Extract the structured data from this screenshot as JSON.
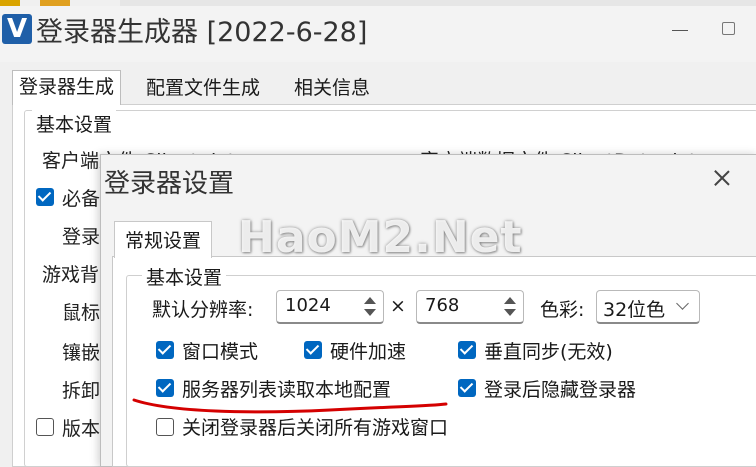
{
  "main_window": {
    "title": "登录器生成器 [2022-6-28]",
    "app_icon_letter": "V",
    "tabs": [
      "登录器生成",
      "配置文件生成",
      "相关信息"
    ],
    "group_title": "基本设置",
    "client_file_label": "客户端文件 Client.dat",
    "client_data_file_label": "客户端数据文件 ClientData.dat",
    "required_label_partial": "必备",
    "login_label_partial": "登录",
    "game_bg_label_partial": "游戏背",
    "mouse_label_partial": "鼠标",
    "embed_label_partial": "镶嵌",
    "split_label_partial": "拆卸",
    "version_label_partial": "版本"
  },
  "dialog": {
    "title": "登录器设置",
    "tabs": [
      "常规设置"
    ],
    "group_title": "基本设置",
    "resolution_label": "默认分辨率:",
    "width": "1024",
    "times": "×",
    "height": "768",
    "color_label": "色彩:",
    "color_value": "32位色",
    "checkboxes": [
      {
        "label": "窗口模式",
        "checked": true
      },
      {
        "label": "硬件加速",
        "checked": true
      },
      {
        "label": "垂直同步(无效)",
        "checked": true
      },
      {
        "label": "服务器列表读取本地配置",
        "checked": true
      },
      {
        "label": "登录后隐藏登录器",
        "checked": true
      },
      {
        "label": "关闭登录器后关闭所有游戏窗口",
        "checked": false
      }
    ]
  },
  "watermark": "HaoM2.Net",
  "colors": {
    "accent": "#0067c0",
    "annotation": "#d40000"
  },
  "icons": [
    "app-logo-icon",
    "minimize-icon",
    "maximize-icon",
    "close-icon",
    "spinner-up-icon",
    "spinner-down-icon",
    "chevron-down-icon",
    "checkmark-icon"
  ]
}
